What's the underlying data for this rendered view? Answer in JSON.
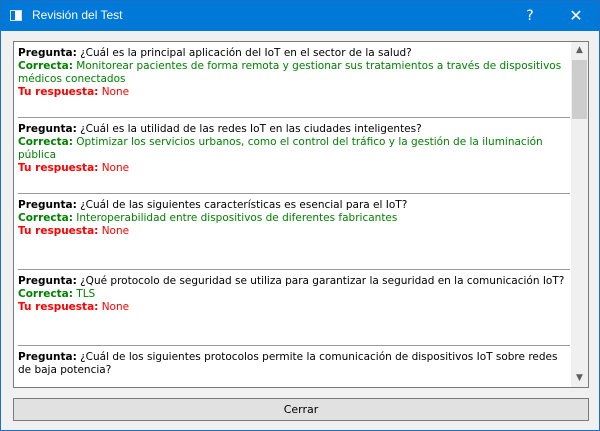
{
  "window": {
    "title": "Revisión del Test",
    "help_symbol": "?",
    "close_symbol": "✕"
  },
  "review": {
    "labels": {
      "question": "Pregunta:",
      "correct": "Correcta:",
      "your_answer": "Tu respuesta:"
    },
    "items": [
      {
        "question": "¿Cuál es la principal aplicación del IoT en el sector de la salud?",
        "correct": "Monitorear pacientes de forma remota y gestionar sus tratamientos a través de dispositivos médicos conectados",
        "your_answer": "None"
      },
      {
        "question": "¿Cuál es la utilidad de las redes IoT en las ciudades inteligentes?",
        "correct": "Optimizar los servicios urbanos, como el control del tráfico y la gestión de la iluminación pública",
        "your_answer": "None"
      },
      {
        "question": "¿Cuál de las siguientes características es esencial para el IoT?",
        "correct": "Interoperabilidad entre dispositivos de diferentes fabricantes",
        "your_answer": "None"
      },
      {
        "question": "¿Qué protocolo de seguridad se utiliza para garantizar la seguridad en la comunicación IoT?",
        "correct": "TLS",
        "your_answer": "None"
      },
      {
        "question": "¿Cuál de los siguientes protocolos permite la comunicación de dispositivos IoT sobre redes de baja potencia?",
        "correct": "",
        "your_answer": ""
      }
    ]
  },
  "buttons": {
    "close": "Cerrar"
  },
  "colors": {
    "titlebar": "#0078d7",
    "correct": "#008000",
    "wrong": "#ff0000"
  }
}
